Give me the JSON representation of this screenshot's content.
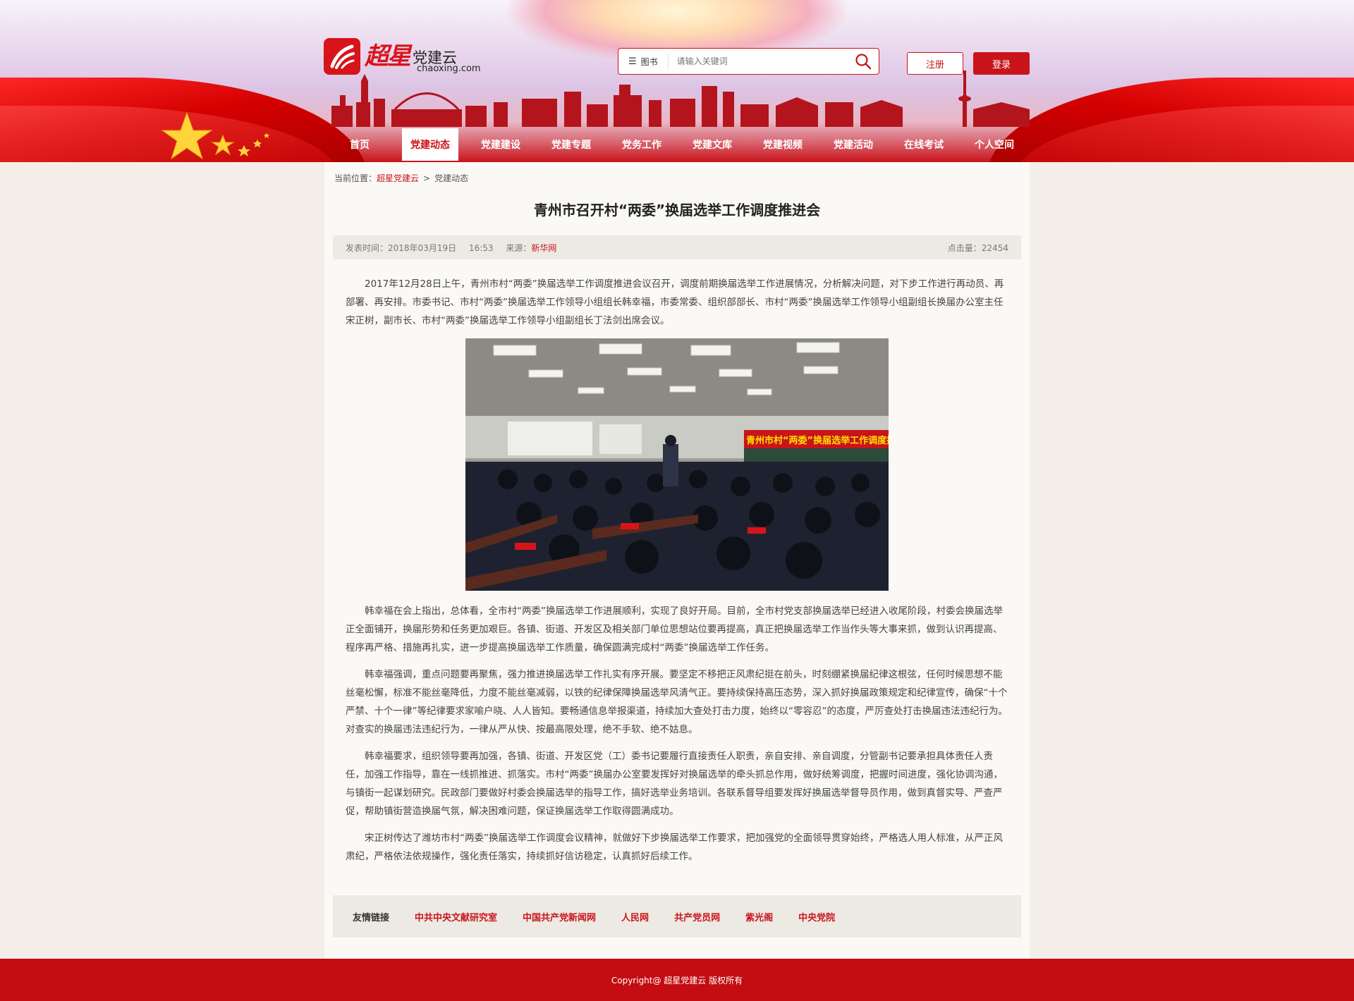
{
  "header": {
    "logo": {
      "brand": "超星",
      "sub": "党建云",
      "url": "chaoxing.com"
    },
    "search": {
      "category": "图书",
      "placeholder": "请输入关键词"
    },
    "register_label": "注册",
    "login_label": "登录"
  },
  "nav": {
    "items": [
      {
        "label": "首页"
      },
      {
        "label": "党建动态"
      },
      {
        "label": "党建建设"
      },
      {
        "label": "党建专题"
      },
      {
        "label": "党务工作"
      },
      {
        "label": "党建文库"
      },
      {
        "label": "党建视频"
      },
      {
        "label": "党建活动"
      },
      {
        "label": "在线考试"
      },
      {
        "label": "个人空间"
      }
    ],
    "active_index": 1
  },
  "breadcrumb": {
    "prefix": "当前位置：",
    "home": "超星党建云",
    "separator": ">",
    "current": "党建动态"
  },
  "article": {
    "title": "青州市召开村“两委”换届选举工作调度推进会",
    "publish_label": "发表时间：",
    "publish_date": "2018年03月19日",
    "publish_time": "16:53",
    "source_label": "来源：",
    "source": "新华网",
    "clicks_label": "点击量：",
    "clicks": "22454",
    "paragraphs": [
      "2017年12月28日上午，青州市村“两委”换届选举工作调度推进会议召开，调度前期换届选举工作进展情况，分析解决问题，对下步工作进行再动员、再部署、再安排。市委书记、市村“两委”换届选举工作领导小组组长韩幸福，市委常委、组织部部长、市村“两委”换届选举工作领导小组副组长换届办公室主任宋正树，副市长、市村“两委”换届选举工作领导小组副组长丁法剑出席会议。",
      "韩幸福在会上指出，总体看，全市村“两委”换届选举工作进展顺利，实现了良好开局。目前，全市村党支部换届选举已经进入收尾阶段，村委会换届选举正全面铺开，换届形势和任务更加艰巨。各镇、街道、开发区及相关部门单位思想站位要再提高，真正把换届选举工作当作头等大事来抓，做到认识再提高、程序再严格、措施再扎实，进一步提高换届选举工作质量，确保圆满完成村“两委”换届选举工作任务。",
      "韩幸福强调，重点问题要再聚焦，强力推进换届选举工作扎实有序开展。要坚定不移把正风肃纪挺在前头，时刻绷紧换届纪律这根弦，任何时候思想不能丝毫松懈，标准不能丝毫降低，力度不能丝毫减弱，以铁的纪律保障换届选举风清气正。要持续保持高压态势，深入抓好换届政策规定和纪律宣传，确保“十个严禁、十个一律”等纪律要求家喻户晓、人人皆知。要畅通信息举报渠道，持续加大查处打击力度，始终以“零容忍”的态度，严厉查处打击换届违法违纪行为。对查实的换届违法违纪行为，一律从严从快、按最高限处理，绝不手软、绝不姑息。",
      "韩幸福要求，组织领导要再加强，各镇、街道、开发区党（工）委书记要履行直接责任人职责，亲自安排、亲自调度，分管副书记要承担具体责任人责任，加强工作指导，靠在一线抓推进、抓落实。市村“两委”换届办公室要发挥好对换届选举的牵头抓总作用，做好统筹调度，把握时间进度，强化协调沟通，与镇街一起谋划研究。民政部门要做好村委会换届选举的指导工作，搞好选举业务培训。各联系督导组要发挥好换届选举督导员作用，做到真督实导、严查严促，帮助镇街营造换届气氛，解决困难问题，保证换届选举工作取得圆满成功。",
      "宋正树传达了潍坊市村“两委”换届选举工作调度会议精神，就做好下步换届选举工作要求，把加强党的全面领导贯穿始终，严格选人用人标准，从严正风肃纪，严格依法依规操作，强化责任落实，持续抓好信访稳定，认真抓好后续工作。"
    ],
    "photo_banner": "青州市村“两委”换届选举工作调度推进会议"
  },
  "friend_links": {
    "label": "友情链接",
    "items": [
      {
        "label": "中共中央文献研究室"
      },
      {
        "label": "中国共产党新闻网"
      },
      {
        "label": "人民网"
      },
      {
        "label": "共产党员网"
      },
      {
        "label": "紫光阁"
      },
      {
        "label": "中央党院"
      }
    ]
  },
  "footer": {
    "copyright": "Copyright@ 超星党建云  版权所有"
  },
  "colors": {
    "brand_red": "#c9141b",
    "footer_red": "#c30d12",
    "page_bg": "#f3efe8",
    "content_bg": "#fbf9f6",
    "meta_bg": "#edeae4"
  }
}
